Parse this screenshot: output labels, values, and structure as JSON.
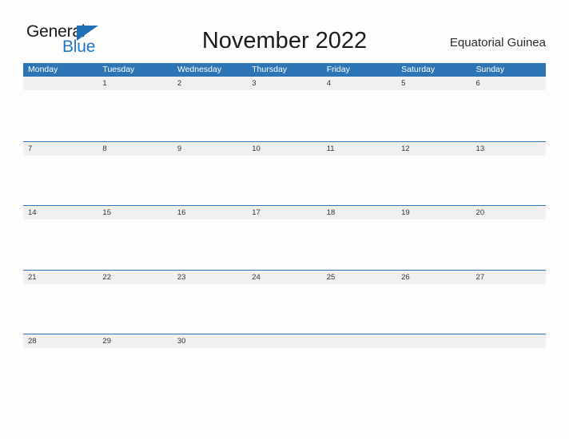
{
  "brand": {
    "name_part1": "General",
    "name_part2": "Blue",
    "flag_icon": "triangle-flag-icon",
    "accent_color": "#2277c4"
  },
  "header": {
    "title": "November 2022",
    "country": "Equatorial Guinea"
  },
  "calendar": {
    "month": "November",
    "year": "2022",
    "header_bg_color": "#2e75b6",
    "date_band_color": "#f0f0f0",
    "row_divider_color": "#2e75b6",
    "day_headers": [
      "Monday",
      "Tuesday",
      "Wednesday",
      "Thursday",
      "Friday",
      "Saturday",
      "Sunday"
    ],
    "weeks": [
      [
        "",
        "1",
        "2",
        "3",
        "4",
        "5",
        "6"
      ],
      [
        "7",
        "8",
        "9",
        "10",
        "11",
        "12",
        "13"
      ],
      [
        "14",
        "15",
        "16",
        "17",
        "18",
        "19",
        "20"
      ],
      [
        "21",
        "22",
        "23",
        "24",
        "25",
        "26",
        "27"
      ],
      [
        "28",
        "29",
        "30",
        "",
        "",
        "",
        ""
      ]
    ]
  }
}
